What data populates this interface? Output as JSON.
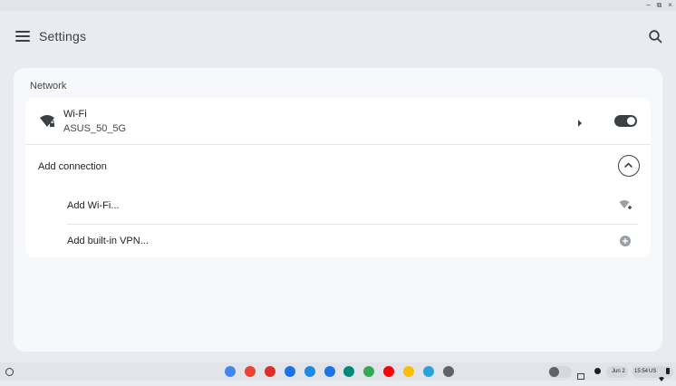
{
  "app": {
    "title": "Settings"
  },
  "window_controls": {
    "minimize": "–",
    "restore": "⧉",
    "close": "×"
  },
  "network": {
    "section_title": "Network",
    "wifi": {
      "name": "Wi-Fi",
      "ssid": "ASUS_50_5G",
      "enabled": true
    },
    "add_connection": {
      "label": "Add connection",
      "expanded": true,
      "items": [
        {
          "label": "Add Wi-Fi...",
          "icon": "wifi-add-icon"
        },
        {
          "label": "Add built-in VPN...",
          "icon": "plus-circle-icon"
        }
      ]
    }
  },
  "shelf": {
    "apps": [
      {
        "name": "assistant",
        "color": "#4285f4"
      },
      {
        "name": "chrome",
        "color": "#ea4335"
      },
      {
        "name": "gmail",
        "color": "#d93025"
      },
      {
        "name": "docs",
        "color": "#1a73e8"
      },
      {
        "name": "files",
        "color": "#1e88e5"
      },
      {
        "name": "messages",
        "color": "#1a73e8"
      },
      {
        "name": "meet",
        "color": "#00897b"
      },
      {
        "name": "play-store",
        "color": "#34a853"
      },
      {
        "name": "youtube",
        "color": "#ff0000"
      },
      {
        "name": "photos",
        "color": "#fbbc04"
      },
      {
        "name": "telegram",
        "color": "#2aa1da"
      },
      {
        "name": "settings",
        "color": "#5f6368"
      }
    ],
    "status": {
      "date": "Jun 2",
      "time": "15:54",
      "region": "US"
    }
  },
  "colors": {
    "accent": "#3c4043",
    "background": "#e9ebf1",
    "panel": "#ffffff"
  }
}
